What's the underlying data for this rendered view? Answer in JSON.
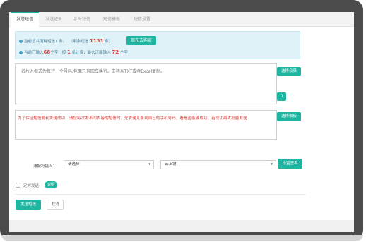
{
  "tabs": [
    "发送短信",
    "发送记录",
    "余时短信",
    "短信模板",
    "短信设置"
  ],
  "info": {
    "line1_prefix": "当前总共消耗短信1 条。",
    "line1_remaining_label": "（剩余短信",
    "line1_remaining_value": "1131",
    "line1_remaining_suffix": "条）",
    "buy_button": "现在去购买",
    "line2_prefix": "当前已输入",
    "line2_chars": "68",
    "line2_mid": "个字，按",
    "line2_count": "1",
    "line2_mid2": "条计费，最大还能输入",
    "line2_max": "72",
    "line2_suffix": "个字"
  },
  "recipients": {
    "placeholder": "名片入框式为每行一个号码,包面只有回车换行。支持从TXT或者Excel复制。",
    "select_member_button": "选择会员",
    "count_badge": "0"
  },
  "message": {
    "value": "为了保证短信顺利发送成功，请您每次发不同内容的短信时，先发送几条到自己的手机号码，看是否能够成功，若成功再大批量发送",
    "select_template_button": "选择模板"
  },
  "channel": {
    "label": "通配符插入：",
    "placeholder_select": "请选择",
    "provider_select": "云上铺",
    "signature_button": "设置签名"
  },
  "schedule": {
    "label": "定时发送",
    "help_pill": "说明"
  },
  "actions": {
    "send": "发送短信",
    "cancel": "取消"
  },
  "colors": {
    "accent": "#1fb5a1",
    "info_bg": "#dff2f7",
    "warning_text": "#d83535",
    "frame": "#4b4b4b"
  }
}
